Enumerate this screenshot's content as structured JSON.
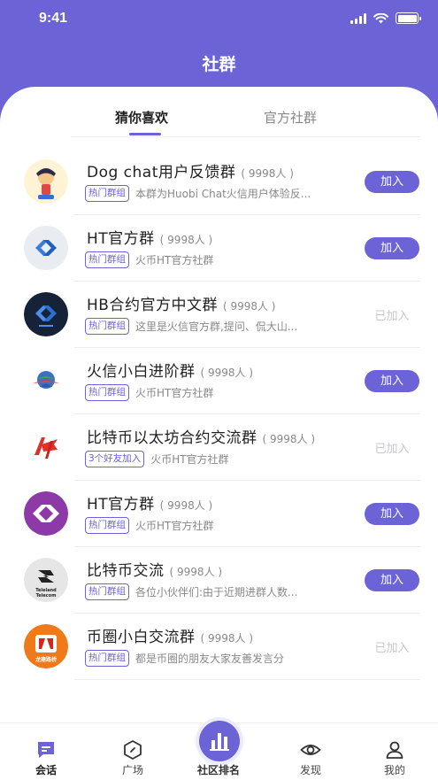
{
  "status": {
    "time": "9:41"
  },
  "header": {
    "title": "社群"
  },
  "tabs": [
    {
      "label": "猜你喜欢"
    },
    {
      "label": "官方社群"
    }
  ],
  "groups": [
    {
      "name": "Dog chat用户反馈群",
      "count": "( 9998人 )",
      "tag": "热门群组",
      "desc": "本群为Huobi Chat火信用户体验反...",
      "action": "加入",
      "joined": false,
      "avatar": "avatar-dogchat"
    },
    {
      "name": "HT官方群",
      "count": "( 9998人 )",
      "tag": "热门群组",
      "desc": "火币HT官方社群",
      "action": "加入",
      "joined": false,
      "avatar": "avatar-ht-grey"
    },
    {
      "name": "HB合约官方中文群",
      "count": "( 9998人 )",
      "tag": "热门群组",
      "desc": "这里是火信官方群,提问、侃大山...",
      "action": "已加入",
      "joined": true,
      "avatar": "avatar-hb-dark"
    },
    {
      "name": "火信小白进阶群",
      "count": "( 9998人 )",
      "tag": "热门群组",
      "desc": "火币HT官方社群",
      "action": "加入",
      "joined": false,
      "avatar": "avatar-huoxin"
    },
    {
      "name": "比特币以太坊合约交流群",
      "count": "( 9998人 )",
      "tag": "3个好友加入",
      "desc": "火币HT官方社群",
      "action": "已加入",
      "joined": true,
      "avatar": "avatar-red-logo"
    },
    {
      "name": "HT官方群",
      "count": "( 9998人 )",
      "tag": "热门群组",
      "desc": "火币HT官方社群",
      "action": "加入",
      "joined": false,
      "avatar": "avatar-ht-purple"
    },
    {
      "name": "比特币交流",
      "count": "( 9998人 )",
      "tag": "热门群组",
      "desc": "各位小伙伴们:由于近期进群人数...",
      "action": "加入",
      "joined": false,
      "avatar": "avatar-teleland"
    },
    {
      "name": "币圈小白交流群",
      "count": "( 9998人 )",
      "tag": "热门群组",
      "desc": "都是币圈的朋友大家友善发言分",
      "action": "已加入",
      "joined": true,
      "avatar": "avatar-orange"
    }
  ],
  "avatar_texts": {
    "teleland": "Teleland Telecom",
    "orange": "龙建路桥"
  },
  "nav": [
    {
      "label": "会话",
      "icon": "chat-icon",
      "active": true
    },
    {
      "label": "广场",
      "icon": "compass-icon",
      "active": false
    },
    {
      "label": "社区排名",
      "icon": "chart-icon",
      "active": false
    },
    {
      "label": "发现",
      "icon": "eye-icon",
      "active": false
    },
    {
      "label": "我的",
      "icon": "user-icon",
      "active": false
    }
  ],
  "colors": {
    "accent": "#6b63d6",
    "muted": "#888888",
    "joined": "#c8c8cc"
  }
}
